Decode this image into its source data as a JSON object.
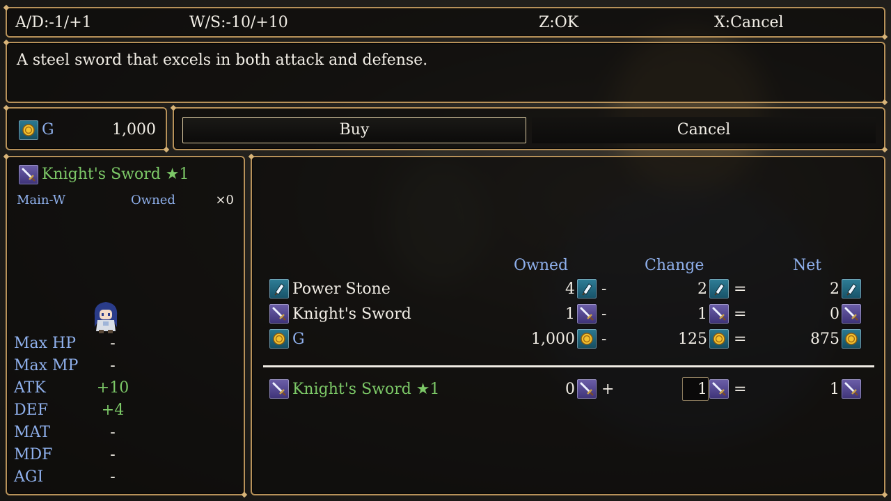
{
  "top_bar": {
    "ad_hint": "A/D:-1/+1",
    "ws_hint": "W/S:-10/+10",
    "ok_hint": "Z:OK",
    "cancel_hint": "X:Cancel"
  },
  "help": {
    "description": "A steel sword that excels in both attack and defense."
  },
  "gold": {
    "currency": "G",
    "amount": "1,000",
    "icon": "coin-icon"
  },
  "command": {
    "buy_label": "Buy",
    "cancel_label": "Cancel"
  },
  "item_status": {
    "name": "Knight's Sword ★1",
    "icon": "sword-icon",
    "equip_type": "Main-W",
    "owned_label": "Owned",
    "owned_count": "×0",
    "params": [
      {
        "label": "Max HP",
        "value": "-"
      },
      {
        "label": "Max MP",
        "value": "-"
      },
      {
        "label": "ATK",
        "value": "+10"
      },
      {
        "label": "DEF",
        "value": "+4"
      },
      {
        "label": "MAT",
        "value": "-"
      },
      {
        "label": "MDF",
        "value": "-"
      },
      {
        "label": "AGI",
        "value": "-"
      }
    ]
  },
  "craft": {
    "headers": {
      "owned": "Owned",
      "change": "Change",
      "net": "Net"
    },
    "materials": [
      {
        "name": "Power Stone",
        "icon": "stone-icon",
        "owned": "4",
        "op": "-",
        "change": "2",
        "eq": "=",
        "net": "2"
      },
      {
        "name": "Knight's Sword",
        "icon": "sword-icon",
        "owned": "1",
        "op": "-",
        "change": "1",
        "eq": "=",
        "net": "0"
      },
      {
        "name": "G",
        "icon": "coin-icon",
        "owned": "1,000",
        "op": "-",
        "change": "125",
        "eq": "=",
        "net": "875"
      }
    ],
    "result": {
      "name": "Knight's Sword ★1",
      "icon": "sword-icon",
      "owned": "0",
      "op": "+",
      "change": "1",
      "eq": "=",
      "net": "1"
    }
  },
  "colors": {
    "frame": "#b8925a",
    "system_blue": "#8fb0ec",
    "item_green": "#7cc867"
  }
}
